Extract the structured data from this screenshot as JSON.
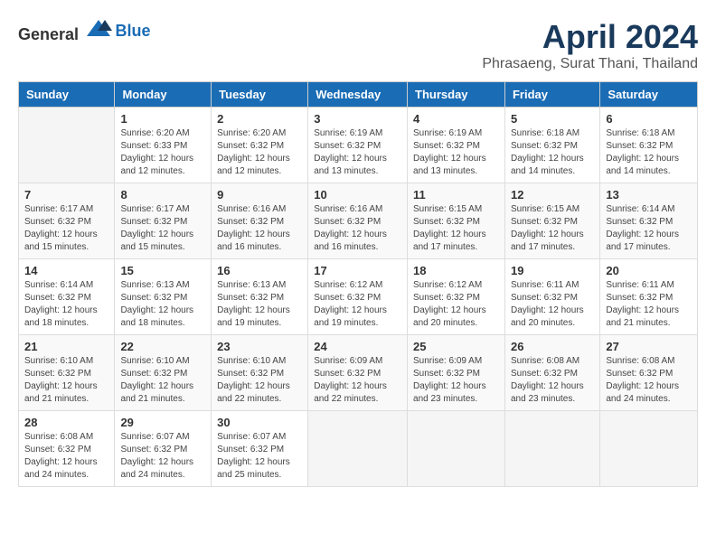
{
  "header": {
    "logo_general": "General",
    "logo_blue": "Blue",
    "title": "April 2024",
    "subtitle": "Phrasaeng, Surat Thani, Thailand"
  },
  "days_of_week": [
    "Sunday",
    "Monday",
    "Tuesday",
    "Wednesday",
    "Thursday",
    "Friday",
    "Saturday"
  ],
  "weeks": [
    [
      {
        "day": "",
        "info": ""
      },
      {
        "day": "1",
        "info": "Sunrise: 6:20 AM\nSunset: 6:33 PM\nDaylight: 12 hours\nand 12 minutes."
      },
      {
        "day": "2",
        "info": "Sunrise: 6:20 AM\nSunset: 6:32 PM\nDaylight: 12 hours\nand 12 minutes."
      },
      {
        "day": "3",
        "info": "Sunrise: 6:19 AM\nSunset: 6:32 PM\nDaylight: 12 hours\nand 13 minutes."
      },
      {
        "day": "4",
        "info": "Sunrise: 6:19 AM\nSunset: 6:32 PM\nDaylight: 12 hours\nand 13 minutes."
      },
      {
        "day": "5",
        "info": "Sunrise: 6:18 AM\nSunset: 6:32 PM\nDaylight: 12 hours\nand 14 minutes."
      },
      {
        "day": "6",
        "info": "Sunrise: 6:18 AM\nSunset: 6:32 PM\nDaylight: 12 hours\nand 14 minutes."
      }
    ],
    [
      {
        "day": "7",
        "info": "Sunrise: 6:17 AM\nSunset: 6:32 PM\nDaylight: 12 hours\nand 15 minutes."
      },
      {
        "day": "8",
        "info": "Sunrise: 6:17 AM\nSunset: 6:32 PM\nDaylight: 12 hours\nand 15 minutes."
      },
      {
        "day": "9",
        "info": "Sunrise: 6:16 AM\nSunset: 6:32 PM\nDaylight: 12 hours\nand 16 minutes."
      },
      {
        "day": "10",
        "info": "Sunrise: 6:16 AM\nSunset: 6:32 PM\nDaylight: 12 hours\nand 16 minutes."
      },
      {
        "day": "11",
        "info": "Sunrise: 6:15 AM\nSunset: 6:32 PM\nDaylight: 12 hours\nand 17 minutes."
      },
      {
        "day": "12",
        "info": "Sunrise: 6:15 AM\nSunset: 6:32 PM\nDaylight: 12 hours\nand 17 minutes."
      },
      {
        "day": "13",
        "info": "Sunrise: 6:14 AM\nSunset: 6:32 PM\nDaylight: 12 hours\nand 17 minutes."
      }
    ],
    [
      {
        "day": "14",
        "info": "Sunrise: 6:14 AM\nSunset: 6:32 PM\nDaylight: 12 hours\nand 18 minutes."
      },
      {
        "day": "15",
        "info": "Sunrise: 6:13 AM\nSunset: 6:32 PM\nDaylight: 12 hours\nand 18 minutes."
      },
      {
        "day": "16",
        "info": "Sunrise: 6:13 AM\nSunset: 6:32 PM\nDaylight: 12 hours\nand 19 minutes."
      },
      {
        "day": "17",
        "info": "Sunrise: 6:12 AM\nSunset: 6:32 PM\nDaylight: 12 hours\nand 19 minutes."
      },
      {
        "day": "18",
        "info": "Sunrise: 6:12 AM\nSunset: 6:32 PM\nDaylight: 12 hours\nand 20 minutes."
      },
      {
        "day": "19",
        "info": "Sunrise: 6:11 AM\nSunset: 6:32 PM\nDaylight: 12 hours\nand 20 minutes."
      },
      {
        "day": "20",
        "info": "Sunrise: 6:11 AM\nSunset: 6:32 PM\nDaylight: 12 hours\nand 21 minutes."
      }
    ],
    [
      {
        "day": "21",
        "info": "Sunrise: 6:10 AM\nSunset: 6:32 PM\nDaylight: 12 hours\nand 21 minutes."
      },
      {
        "day": "22",
        "info": "Sunrise: 6:10 AM\nSunset: 6:32 PM\nDaylight: 12 hours\nand 21 minutes."
      },
      {
        "day": "23",
        "info": "Sunrise: 6:10 AM\nSunset: 6:32 PM\nDaylight: 12 hours\nand 22 minutes."
      },
      {
        "day": "24",
        "info": "Sunrise: 6:09 AM\nSunset: 6:32 PM\nDaylight: 12 hours\nand 22 minutes."
      },
      {
        "day": "25",
        "info": "Sunrise: 6:09 AM\nSunset: 6:32 PM\nDaylight: 12 hours\nand 23 minutes."
      },
      {
        "day": "26",
        "info": "Sunrise: 6:08 AM\nSunset: 6:32 PM\nDaylight: 12 hours\nand 23 minutes."
      },
      {
        "day": "27",
        "info": "Sunrise: 6:08 AM\nSunset: 6:32 PM\nDaylight: 12 hours\nand 24 minutes."
      }
    ],
    [
      {
        "day": "28",
        "info": "Sunrise: 6:08 AM\nSunset: 6:32 PM\nDaylight: 12 hours\nand 24 minutes."
      },
      {
        "day": "29",
        "info": "Sunrise: 6:07 AM\nSunset: 6:32 PM\nDaylight: 12 hours\nand 24 minutes."
      },
      {
        "day": "30",
        "info": "Sunrise: 6:07 AM\nSunset: 6:32 PM\nDaylight: 12 hours\nand 25 minutes."
      },
      {
        "day": "",
        "info": ""
      },
      {
        "day": "",
        "info": ""
      },
      {
        "day": "",
        "info": ""
      },
      {
        "day": "",
        "info": ""
      }
    ]
  ]
}
